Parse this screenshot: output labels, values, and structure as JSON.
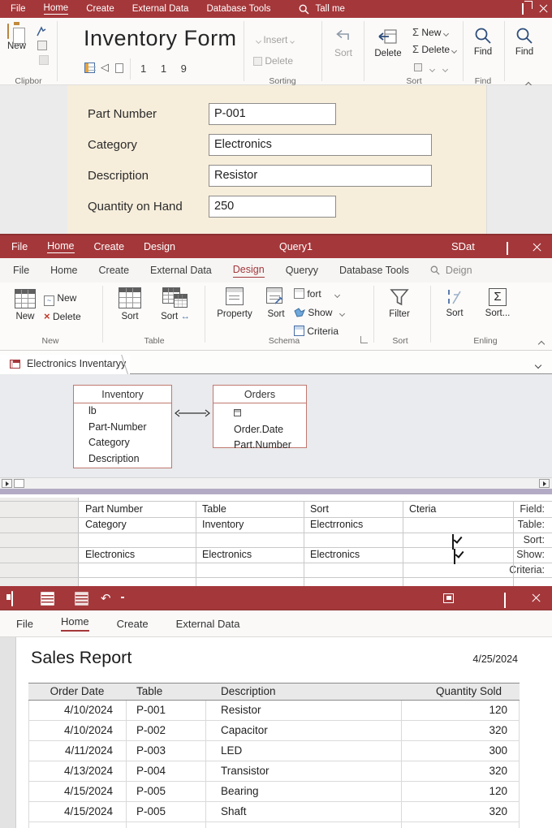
{
  "icons": {
    "sigma": "Σ",
    "double_arrow": "↔",
    "undo": "↶",
    "prev_triangle": "◁"
  },
  "win1": {
    "titlebar": {
      "tabs": [
        "File",
        "Home",
        "Create",
        "External Data",
        "Database Tools"
      ],
      "search_label": "Tall me"
    },
    "ribbon": {
      "new_label": "New",
      "clipboard_group_label": "Clipbor",
      "doc_title": "Inventory Form",
      "record_indicator": "1 1  9",
      "insert_label": "Insert",
      "delete_label": "Delete",
      "sorting_group_label": "Sorting",
      "sort_button_label": "Sort",
      "delete_big_label": "Delete",
      "sum_new_label": "New",
      "sum_delete_label": "Delete",
      "sort_group_label": "Sort",
      "find_label": "Find",
      "find_group_label": "Find",
      "find2_label": "Find"
    },
    "form": {
      "fields": [
        {
          "label": "Part Number",
          "value": "P-001"
        },
        {
          "label": "Category",
          "value": "Electronics"
        },
        {
          "label": "Description",
          "value": "Resistor"
        },
        {
          "label": "Quantity on Hand",
          "value": "250"
        }
      ]
    }
  },
  "win2": {
    "titlebar": {
      "tabs": [
        "File",
        "Home",
        "Create",
        "Design"
      ],
      "title": "Query1",
      "right_label": "SDat"
    },
    "menubar": {
      "items": [
        "File",
        "Home",
        "Create",
        "External Data",
        "Design",
        "Queryy",
        "Database Tools"
      ],
      "search_label": "Deign"
    },
    "ribbon": {
      "new_big_label": "New",
      "new_small_label": "New",
      "delete_small_label": "Delete",
      "new_group_label": "New",
      "table_sort1_label": "Sort",
      "table_sort2_label": "Sort",
      "table_group_label": "Table",
      "property_label": "Property",
      "schema_sort_label": "Sort",
      "fort_label": "fort",
      "show_label": "Show",
      "criteria_label": "Criteria",
      "schema_group_label": "Schema",
      "filter_label": "Filter",
      "filter_group_label": "Sort",
      "ending_sort1_label": "Sort",
      "ending_sort2_label": "Sort...",
      "ending_group_label": "Enling"
    },
    "tab_label": "Electronics Inventaryy",
    "diagram": {
      "tables": [
        {
          "name": "Inventory",
          "fields": [
            "lb",
            "Part-Number",
            "Category",
            "Description"
          ]
        },
        {
          "name": "Orders",
          "fields": [
            "Order.Date",
            "Part.Number"
          ]
        }
      ]
    },
    "grid": {
      "row_labels": [
        "Field:",
        "Table:",
        "Sort:",
        "Show:",
        "Criteria:"
      ],
      "field_row": [
        "Part Number",
        "Table",
        "Sort",
        "Cteria"
      ],
      "table_row": [
        "Category",
        "Inventory",
        "Electrronics"
      ],
      "show_row": [
        "Electronics",
        "Electronics",
        "Electronics"
      ]
    }
  },
  "win3": {
    "menubar": [
      "File",
      "Home",
      "Create",
      "External Data"
    ],
    "report": {
      "title": "Sales Report",
      "date": "4/25/2024",
      "columns": [
        "Order Date",
        "Table",
        "Description",
        "Quantity Sold"
      ],
      "rows": [
        {
          "date": "4/10/2024",
          "part": "P-001",
          "desc": "Resistor",
          "qty": "120"
        },
        {
          "date": "4/10/2024",
          "part": "P-002",
          "desc": "Capacitor",
          "qty": "320"
        },
        {
          "date": "4/11/2024",
          "part": "P-003",
          "desc": "LED",
          "qty": "300"
        },
        {
          "date": "4/13/2024",
          "part": "P-004",
          "desc": "Transistor",
          "qty": "320"
        },
        {
          "date": "4/15/2024",
          "part": "P-005",
          "desc": "Bearing",
          "qty": "120"
        },
        {
          "date": "4/15/2024",
          "part": "P-005",
          "desc": "Shaft",
          "qty": "320"
        }
      ]
    }
  }
}
